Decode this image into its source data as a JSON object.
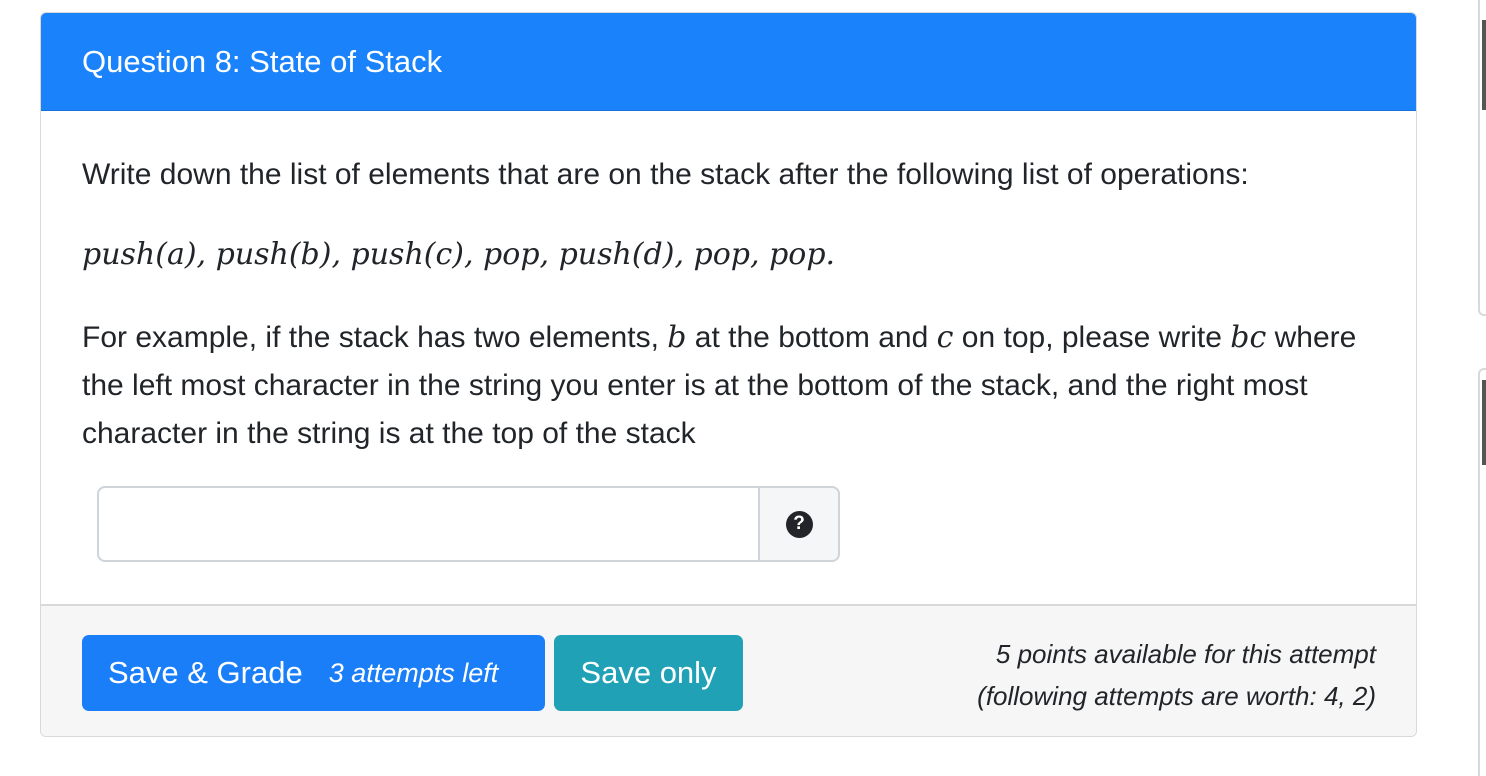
{
  "question": {
    "title": "Question 8: State of Stack",
    "prompt": "Write down the list of elements that are on the stack after the following list of operations:",
    "operations": "push(a), push(b), push(c), pop, push(d), pop, pop.",
    "example_part1": "For example, if the stack has two elements, ",
    "example_var_b": "b",
    "example_part2": " at the bottom and ",
    "example_var_c": "c",
    "example_part3": " on top, please write ",
    "example_var_bc": "bc",
    "example_part4": " where the left most character in the string you enter is at the bottom of the stack, and the right most character in the string is at the top of the stack"
  },
  "answer": {
    "value": "",
    "placeholder": "",
    "help_icon_glyph": "?"
  },
  "footer": {
    "grade_button_label": "Save & Grade",
    "attempts_left": "3 attempts left",
    "save_only_label": "Save only",
    "points_line1": "5 points available for this attempt",
    "points_line2": "(following attempts are worth: 4, 2)"
  },
  "colors": {
    "header_bg": "#1a82fb",
    "grade_button_bg": "#1a7ef9",
    "save_button_bg": "#20a1b5",
    "footer_bg": "#f6f6f6"
  }
}
